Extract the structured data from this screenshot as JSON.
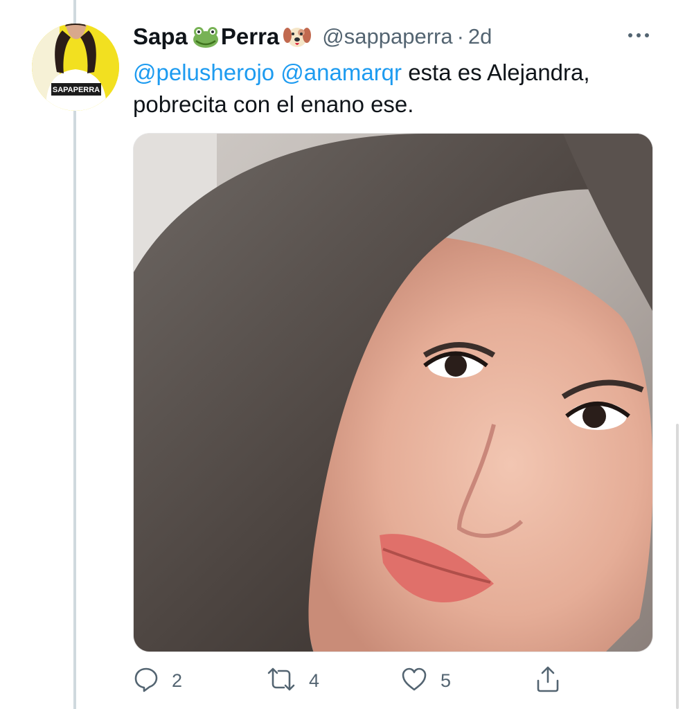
{
  "tweet": {
    "author": {
      "name_part1": "Sapa",
      "name_part2": "Perra",
      "emoji1": "frog-emoji",
      "emoji2": "dog-emoji",
      "handle": "@sappaperra",
      "avatar_shirt_text": "SAPAPERRA"
    },
    "separator": "·",
    "time": "2d",
    "text": {
      "mention1": "@pelusherojo",
      "mention2": "@anamarqr",
      "body_line1": "esta es Alejandra,",
      "body_line2": "pobrecita con el enano ese."
    },
    "actions": {
      "reply_count": "2",
      "retweet_count": "4",
      "like_count": "5"
    }
  },
  "icons": {
    "more": "more-horizontal-icon",
    "reply": "reply-icon",
    "retweet": "retweet-icon",
    "like": "heart-icon",
    "share": "share-icon"
  },
  "colors": {
    "link": "#1d9bf0",
    "text": "#0f1419",
    "secondary": "#536471",
    "thread_line": "#cfd9de",
    "avatar_background": "#f2e020"
  }
}
